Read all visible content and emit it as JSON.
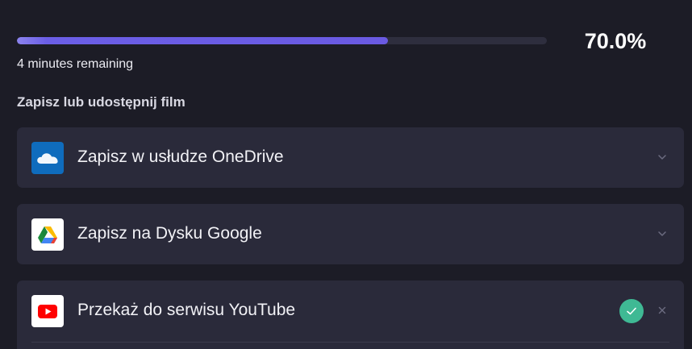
{
  "progress": {
    "percent_label": "70.0%",
    "fraction": 0.7,
    "remaining_text": "4 minutes remaining",
    "fill_color": "#6a5ae2"
  },
  "share": {
    "title": "Zapisz lub udostępnij film",
    "items": [
      {
        "label": "Zapisz w usłudze OneDrive",
        "icon": "onedrive-icon",
        "trailing": "chevron-down-icon"
      },
      {
        "label": "Zapisz na Dysku Google",
        "icon": "google-drive-icon",
        "trailing": "chevron-down-icon"
      },
      {
        "label": "Przekaż do serwisu YouTube",
        "icon": "youtube-icon",
        "trailing": "close-icon",
        "status": "check-icon",
        "status_color": "#3fb994"
      }
    ]
  }
}
